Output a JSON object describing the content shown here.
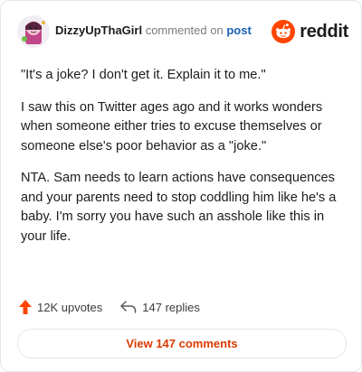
{
  "header": {
    "username": "DizzyUpThaGirl",
    "action_text": "commented on",
    "post_link": "post",
    "brand": "reddit"
  },
  "comment": {
    "paragraphs": [
      "\"It's a joke? I don't get it. Explain it to me.\"",
      "I saw this on Twitter ages ago and it works wonders when someone either tries to excuse themselves or someone else's poor behavior as a \"joke.\"",
      "NTA. Sam needs to learn actions have consequences and your parents need to stop coddling him like he's a baby. I'm sorry you have such an asshole like this in your life."
    ]
  },
  "stats": {
    "upvotes": "12K upvotes",
    "replies": "147 replies"
  },
  "footer": {
    "view_comments": "View 147 comments"
  },
  "colors": {
    "accent": "#FF4500",
    "button_text": "#D93A00",
    "link": "#1A5FB4"
  },
  "icons": [
    "avatar-image",
    "reddit-snoo-icon",
    "upvote-arrow-icon",
    "reply-arrow-icon"
  ]
}
